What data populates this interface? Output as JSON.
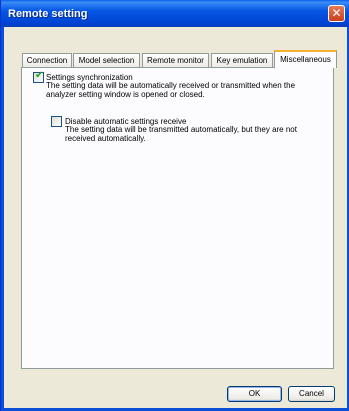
{
  "window": {
    "title": "Remote setting",
    "close_glyph": "✕"
  },
  "tabs": [
    {
      "label": "Connection"
    },
    {
      "label": "Model selection"
    },
    {
      "label": "Remote monitor"
    },
    {
      "label": "Key emulation"
    },
    {
      "label": "Miscellaneous"
    }
  ],
  "active_tab": "Miscellaneous",
  "settings": {
    "sync": {
      "label": "Settings synchronization",
      "checked": true,
      "description": "The setting data will be automatically received or transmitted when the analyzer setting window is opened or closed."
    },
    "disable_receive": {
      "label": "Disable automatic settings receive",
      "checked": false,
      "description": "The setting data will be transmitted automatically, but they are not received automatically."
    }
  },
  "buttons": {
    "ok": "OK",
    "cancel": "Cancel"
  },
  "icons": {
    "check": "✔"
  },
  "colors": {
    "title_bar": "#0556e2",
    "close_button": "#c8411c",
    "active_tab_highlight": "#f5b031",
    "checkmark": "#21a121"
  }
}
